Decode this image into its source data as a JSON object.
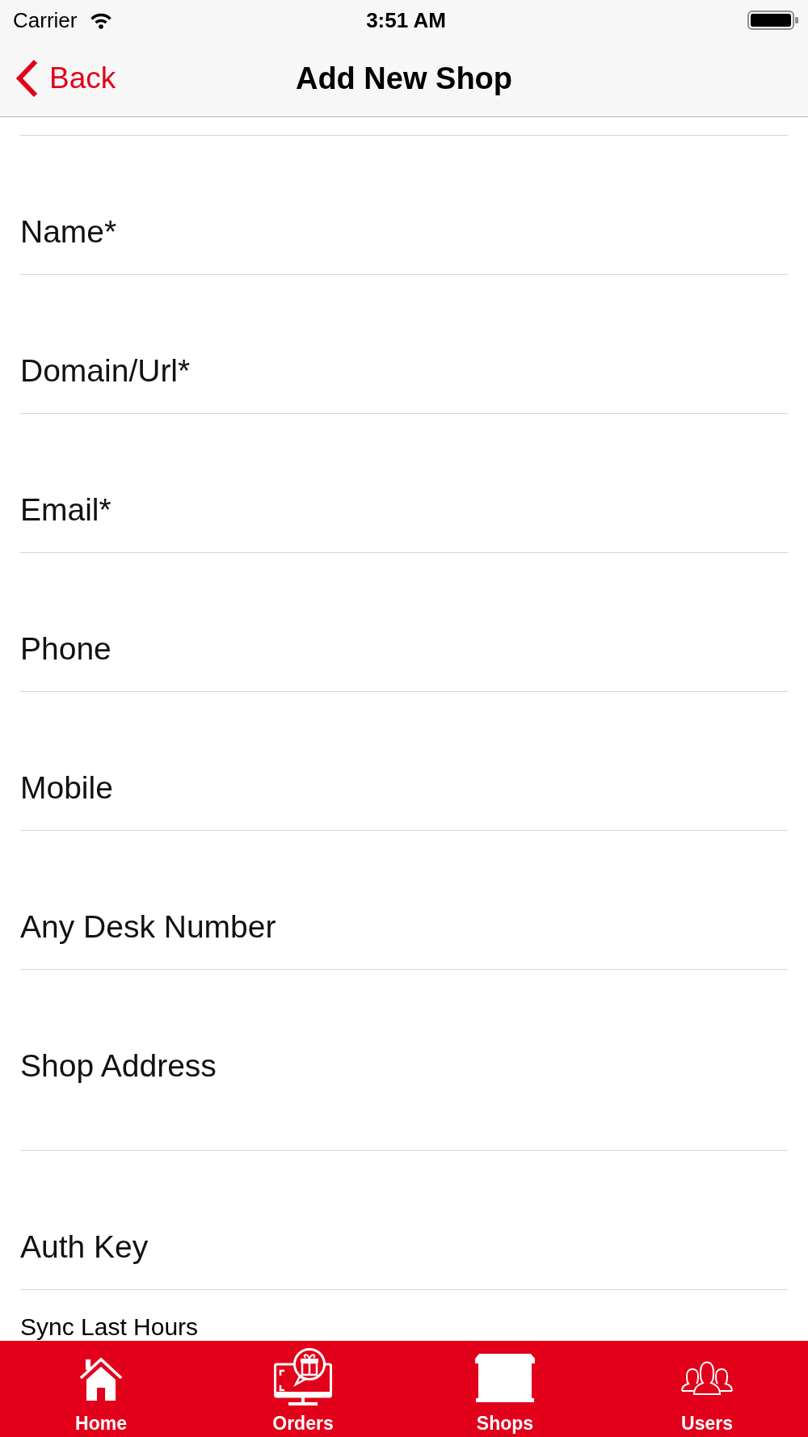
{
  "status_bar": {
    "carrier": "Carrier",
    "time": "3:51 AM"
  },
  "nav_bar": {
    "back_label": "Back",
    "title": "Add New Shop"
  },
  "form": {
    "fields": [
      {
        "kind": "text",
        "placeholder": "Name*"
      },
      {
        "kind": "text",
        "placeholder": "Domain/Url*"
      },
      {
        "kind": "text",
        "placeholder": "Email*"
      },
      {
        "kind": "text",
        "placeholder": "Phone"
      },
      {
        "kind": "text",
        "placeholder": "Mobile"
      },
      {
        "kind": "text",
        "placeholder": "Any Desk Number"
      },
      {
        "kind": "multiline",
        "placeholder": "Shop Address"
      },
      {
        "kind": "text",
        "placeholder": "Auth Key"
      }
    ],
    "sync_label": "Sync Last Hours"
  },
  "tab_bar": {
    "items": [
      {
        "label": "Home"
      },
      {
        "label": "Orders"
      },
      {
        "label": "Shops"
      },
      {
        "label": "Users"
      }
    ]
  }
}
